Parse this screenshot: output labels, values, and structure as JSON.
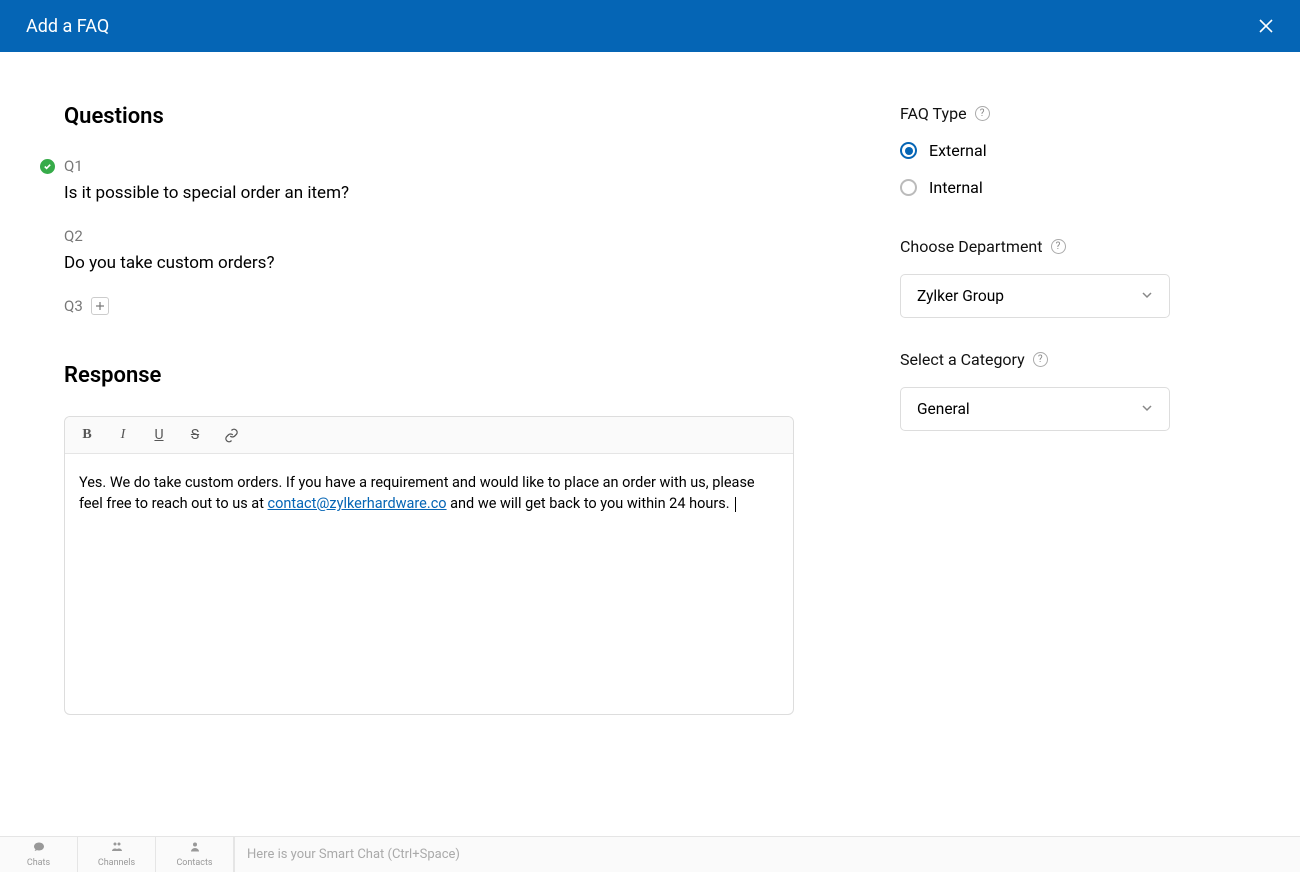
{
  "header": {
    "title": "Add a FAQ"
  },
  "questions": {
    "heading": "Questions",
    "items": [
      {
        "label": "Q1",
        "text": "Is it possible to special order an item?",
        "complete": true
      },
      {
        "label": "Q2",
        "text": "Do you take custom orders?",
        "complete": false
      },
      {
        "label": "Q3",
        "text": "",
        "complete": false
      }
    ]
  },
  "response": {
    "heading": "Response",
    "text_before": "Yes. We do take custom orders. If you have a requirement and would like to place an order with us, please feel free to reach out to us at ",
    "link_text": "contact@zylkerhardware.co",
    "text_after": " and we will get back to you within 24 hours. "
  },
  "sidebar": {
    "faq_type": {
      "label": "FAQ Type",
      "options": [
        "External",
        "Internal"
      ],
      "selected": "External"
    },
    "department": {
      "label": "Choose Department",
      "value": "Zylker Group"
    },
    "category": {
      "label": "Select a Category",
      "value": "General"
    }
  },
  "bottom": {
    "tabs": [
      "Chats",
      "Channels",
      "Contacts"
    ],
    "smart_chat_placeholder": "Here is your Smart Chat (Ctrl+Space)"
  }
}
